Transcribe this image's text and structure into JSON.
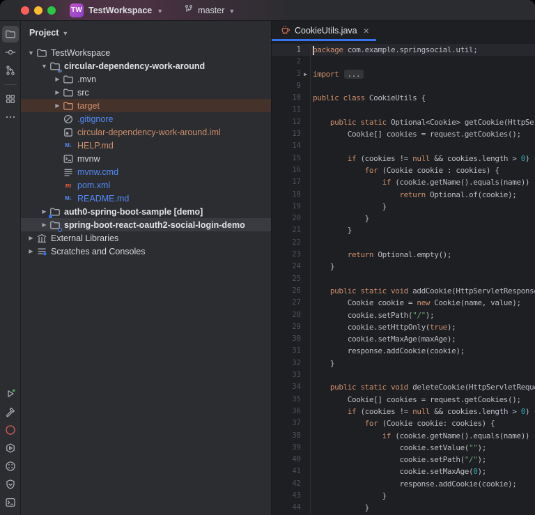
{
  "palette": {
    "accent_blue": "#3574f0",
    "keyword_orange": "#cf8e6d",
    "string_green": "#6aab73",
    "number_teal": "#2aacb8",
    "excluded_row_bg": "#45322b",
    "selected_row_bg": "#393b40",
    "blue_file_text": "#548af7",
    "editor_bg": "#1e1f22",
    "panel_bg": "#2b2d30",
    "problems_red": "#db5c5c",
    "run_green": "#28c840"
  },
  "titlebar": {
    "project_badge": "TW",
    "project_name": "TestWorkspace",
    "branch_name": "master"
  },
  "left_rail": {
    "top": [
      {
        "id": "project-tool-button",
        "icon": "folder",
        "selected": true
      },
      {
        "id": "commit-tool-button",
        "icon": "commit",
        "selected": false
      },
      {
        "id": "vcs-tool-button",
        "icon": "branch-nodes",
        "selected": false
      }
    ],
    "mid": [
      {
        "id": "structure-tool-button",
        "icon": "structure",
        "selected": false
      },
      {
        "id": "more-tools-button",
        "icon": "more-dots",
        "selected": false
      }
    ],
    "bottom": [
      {
        "id": "run-tool-button",
        "icon": "run",
        "selected": false
      },
      {
        "id": "build-tool-button",
        "icon": "hammer",
        "selected": false
      },
      {
        "id": "problems-tool-button",
        "icon": "error-wave",
        "selected": false
      },
      {
        "id": "services-tool-button",
        "icon": "services-play",
        "selected": false
      },
      {
        "id": "coverage-tool-button",
        "icon": "dotted-circle",
        "selected": false
      },
      {
        "id": "dependencies-tool-button",
        "icon": "shield",
        "selected": false
      },
      {
        "id": "terminal-tool-button",
        "icon": "terminal",
        "selected": false
      }
    ]
  },
  "project_panel": {
    "header_label": "Project",
    "tree": [
      {
        "id": "testworkspace",
        "label": "TestWorkspace",
        "depth": 0,
        "chevron": "down",
        "icon": "folder"
      },
      {
        "id": "circular-dependency-work-around",
        "label": "circular-dependency-work-around",
        "depth": 1,
        "chevron": "down",
        "icon": "folder-module",
        "bold": true
      },
      {
        "id": "mvn",
        "label": ".mvn",
        "depth": 2,
        "chevron": "right",
        "icon": "folder"
      },
      {
        "id": "src",
        "label": "src",
        "depth": 2,
        "chevron": "right",
        "icon": "folder"
      },
      {
        "id": "target",
        "label": "target",
        "depth": 2,
        "chevron": "right",
        "icon": "folder-orange",
        "color": "orange",
        "row": "excluded"
      },
      {
        "id": "gitignore",
        "label": ".gitignore",
        "depth": 2,
        "chevron": null,
        "icon": "ignored",
        "color": "blue"
      },
      {
        "id": "iml-file",
        "label": "circular-dependency-work-around.iml",
        "depth": 2,
        "chevron": null,
        "icon": "iml",
        "color": "orange"
      },
      {
        "id": "help-md",
        "label": "HELP.md",
        "depth": 2,
        "chevron": null,
        "icon": "markdown",
        "color": "orange"
      },
      {
        "id": "mvnw",
        "label": "mvnw",
        "depth": 2,
        "chevron": null,
        "icon": "shell"
      },
      {
        "id": "mvnw-cmd",
        "label": "mvnw.cmd",
        "depth": 2,
        "chevron": null,
        "icon": "textfile",
        "color": "blue"
      },
      {
        "id": "pom-xml",
        "label": "pom.xml",
        "depth": 2,
        "chevron": null,
        "icon": "maven",
        "color": "blue"
      },
      {
        "id": "readme-md",
        "label": "README.md",
        "depth": 2,
        "chevron": null,
        "icon": "markdown",
        "color": "blue"
      },
      {
        "id": "auth0-spring-boot-sample",
        "label": "auth0-spring-boot-sample [demo]",
        "depth": 1,
        "chevron": "right",
        "icon": "folder-demo",
        "bold": true
      },
      {
        "id": "spring-boot-react-oauth2-social-login-demo",
        "label": "spring-boot-react-oauth2-social-login-demo",
        "depth": 1,
        "chevron": "right",
        "icon": "folder-link",
        "bold": true,
        "row": "selected"
      },
      {
        "id": "external-libraries",
        "label": "External Libraries",
        "depth": 0,
        "chevron": "right",
        "icon": "library"
      },
      {
        "id": "scratches-and-consoles",
        "label": "Scratches and Consoles",
        "depth": 0,
        "chevron": "right",
        "icon": "scratches"
      }
    ]
  },
  "editor": {
    "tab": {
      "label": "CookieUtils.java",
      "icon": "java-cup"
    },
    "lines": [
      {
        "n": "1",
        "cur": true,
        "caret": true,
        "t": [
          [
            "kw",
            "package"
          ],
          [
            "pl",
            " com.example.springsocial.util;"
          ]
        ]
      },
      {
        "n": "2",
        "t": []
      },
      {
        "n": "3",
        "fold": true,
        "t": [
          [
            "kw",
            "import"
          ],
          [
            "pl",
            " "
          ],
          [
            "fold",
            "..."
          ]
        ]
      },
      {
        "n": "9",
        "t": []
      },
      {
        "n": "10",
        "t": [
          [
            "kw",
            "public class"
          ],
          [
            "pl",
            " CookieUtils {"
          ]
        ]
      },
      {
        "n": "11",
        "t": []
      },
      {
        "n": "12",
        "t": [
          [
            "pl",
            "    "
          ],
          [
            "kw",
            "public static"
          ],
          [
            "pl",
            " Optional<Cookie> getCookie(HttpServ"
          ]
        ]
      },
      {
        "n": "13",
        "t": [
          [
            "pl",
            "        Cookie[] cookies = request.getCookies();"
          ]
        ]
      },
      {
        "n": "14",
        "t": []
      },
      {
        "n": "15",
        "t": [
          [
            "pl",
            "        "
          ],
          [
            "kw",
            "if"
          ],
          [
            "pl",
            " (cookies != "
          ],
          [
            "kw",
            "null"
          ],
          [
            "pl",
            " && cookies.length > "
          ],
          [
            "num",
            "0"
          ],
          [
            "pl",
            ") {"
          ]
        ]
      },
      {
        "n": "16",
        "t": [
          [
            "pl",
            "            "
          ],
          [
            "kw",
            "for"
          ],
          [
            "pl",
            " (Cookie cookie : cookies) {"
          ]
        ]
      },
      {
        "n": "17",
        "t": [
          [
            "pl",
            "                "
          ],
          [
            "kw",
            "if"
          ],
          [
            "pl",
            " (cookie.getName().equals(name)) {"
          ]
        ]
      },
      {
        "n": "18",
        "t": [
          [
            "pl",
            "                    "
          ],
          [
            "kw",
            "return"
          ],
          [
            "pl",
            " Optional.of(cookie);"
          ]
        ]
      },
      {
        "n": "19",
        "t": [
          [
            "pl",
            "                }"
          ]
        ]
      },
      {
        "n": "20",
        "t": [
          [
            "pl",
            "            }"
          ]
        ]
      },
      {
        "n": "21",
        "t": [
          [
            "pl",
            "        }"
          ]
        ]
      },
      {
        "n": "22",
        "t": []
      },
      {
        "n": "23",
        "t": [
          [
            "pl",
            "        "
          ],
          [
            "kw",
            "return"
          ],
          [
            "pl",
            " Optional.empty();"
          ]
        ]
      },
      {
        "n": "24",
        "t": [
          [
            "pl",
            "    }"
          ]
        ]
      },
      {
        "n": "25",
        "t": []
      },
      {
        "n": "26",
        "t": [
          [
            "pl",
            "    "
          ],
          [
            "kw",
            "public static void"
          ],
          [
            "pl",
            " addCookie(HttpServletResponse"
          ]
        ]
      },
      {
        "n": "27",
        "t": [
          [
            "pl",
            "        Cookie cookie = "
          ],
          [
            "kw",
            "new"
          ],
          [
            "pl",
            " Cookie(name, value);"
          ]
        ]
      },
      {
        "n": "28",
        "t": [
          [
            "pl",
            "        cookie.setPath("
          ],
          [
            "str",
            "\"/\""
          ],
          [
            "pl",
            ");"
          ]
        ]
      },
      {
        "n": "29",
        "t": [
          [
            "pl",
            "        cookie.setHttpOnly("
          ],
          [
            "kw",
            "true"
          ],
          [
            "pl",
            ");"
          ]
        ]
      },
      {
        "n": "30",
        "t": [
          [
            "pl",
            "        cookie.setMaxAge(maxAge);"
          ]
        ]
      },
      {
        "n": "31",
        "t": [
          [
            "pl",
            "        response.addCookie(cookie);"
          ]
        ]
      },
      {
        "n": "32",
        "t": [
          [
            "pl",
            "    }"
          ]
        ]
      },
      {
        "n": "33",
        "t": []
      },
      {
        "n": "34",
        "t": [
          [
            "pl",
            "    "
          ],
          [
            "kw",
            "public static void"
          ],
          [
            "pl",
            " deleteCookie(HttpServletReques"
          ]
        ]
      },
      {
        "n": "35",
        "t": [
          [
            "pl",
            "        Cookie[] cookies = request.getCookies();"
          ]
        ]
      },
      {
        "n": "36",
        "t": [
          [
            "pl",
            "        "
          ],
          [
            "kw",
            "if"
          ],
          [
            "pl",
            " (cookies != "
          ],
          [
            "kw",
            "null"
          ],
          [
            "pl",
            " && cookies.length > "
          ],
          [
            "num",
            "0"
          ],
          [
            "pl",
            ") {"
          ]
        ]
      },
      {
        "n": "37",
        "t": [
          [
            "pl",
            "            "
          ],
          [
            "kw",
            "for"
          ],
          [
            "pl",
            " (Cookie cookie: cookies) {"
          ]
        ]
      },
      {
        "n": "38",
        "t": [
          [
            "pl",
            "                "
          ],
          [
            "kw",
            "if"
          ],
          [
            "pl",
            " (cookie.getName().equals(name)) {"
          ]
        ]
      },
      {
        "n": "39",
        "t": [
          [
            "pl",
            "                    cookie.setValue("
          ],
          [
            "str",
            "\"\""
          ],
          [
            "pl",
            ");"
          ]
        ]
      },
      {
        "n": "40",
        "t": [
          [
            "pl",
            "                    cookie.setPath("
          ],
          [
            "str",
            "\"/\""
          ],
          [
            "pl",
            ");"
          ]
        ]
      },
      {
        "n": "41",
        "t": [
          [
            "pl",
            "                    cookie.setMaxAge("
          ],
          [
            "num",
            "0"
          ],
          [
            "pl",
            ");"
          ]
        ]
      },
      {
        "n": "42",
        "t": [
          [
            "pl",
            "                    response.addCookie(cookie);"
          ]
        ]
      },
      {
        "n": "43",
        "t": [
          [
            "pl",
            "                }"
          ]
        ]
      },
      {
        "n": "44",
        "t": [
          [
            "pl",
            "            }"
          ]
        ]
      }
    ]
  }
}
